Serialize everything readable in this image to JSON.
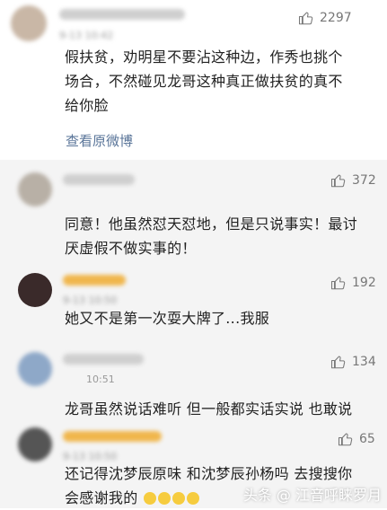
{
  "comments": [
    {
      "time": "9-13 10:42",
      "likes": "2297",
      "lines": [
        "假扶贫，劝明星不要沾这种边，作秀也挑个",
        "场合，不然碰见龙哥这种真正做扶贫的真不",
        "给你脸"
      ],
      "link": "查看原微博"
    }
  ],
  "replies": [
    {
      "time": "",
      "likes": "372",
      "lines": [
        "同意！他虽然怼天怼地，但是只说事实！最讨",
        "厌虚假不做实事的！"
      ]
    },
    {
      "time": "9-13 10:50",
      "likes": "192",
      "lines": [
        "她又不是第一次耍大牌了...我服"
      ]
    },
    {
      "time": "10:51",
      "likes": "134",
      "lines": [
        "龙哥虽然说话难听  但一般都实话实说  也敢说"
      ]
    },
    {
      "time": "9-13 10:50",
      "likes": "65",
      "lines": [
        "还记得沈梦辰原味  和沈梦辰孙杨吗  去搜搜你",
        "会感谢我的"
      ]
    }
  ],
  "watermark": "头条 @ 江音呼睐罗月",
  "colors": {
    "link": "#5a7599",
    "reply_bg": "#f4f4f4",
    "emoji": "#f6cc3f"
  },
  "icons": [
    "thumbs-up-icon",
    "avatar",
    "emoji-icon"
  ]
}
